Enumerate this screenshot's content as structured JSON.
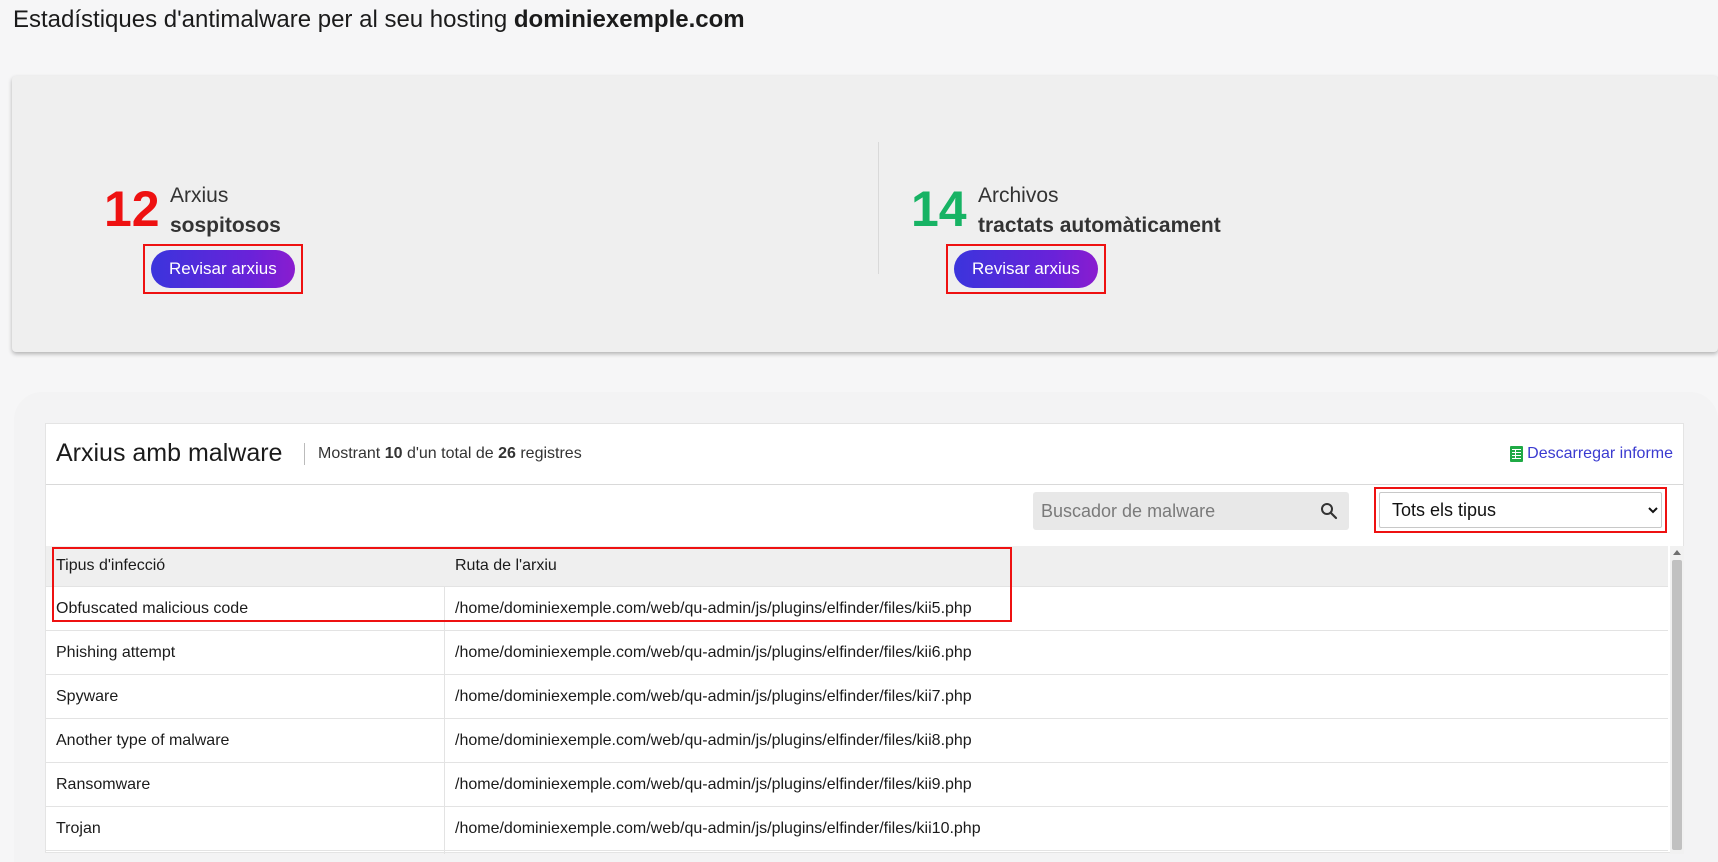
{
  "page": {
    "title_prefix": "Estadístiques d'antimalware per al seu hosting",
    "domain": "dominiexemple.com"
  },
  "stats": {
    "suspicious": {
      "count": "12",
      "line1": "Arxius",
      "line2": "sospitosos",
      "button": "Revisar arxius"
    },
    "treated": {
      "count": "14",
      "line1": "Archivos",
      "line2": "tractats automàticament",
      "button": "Revisar arxius"
    }
  },
  "list": {
    "title": "Arxius amb malware",
    "count_prefix": "Mostrant",
    "count_shown": "10",
    "count_middle": "d'un total de",
    "count_total": "26",
    "count_suffix": "registres",
    "download_label": "Descarregar informe",
    "search_placeholder": "Buscador de malware",
    "filter_selected": "Tots els tipus",
    "columns": [
      "Tipus d'infecció",
      "Ruta de l'arxiu"
    ],
    "rows": [
      {
        "type": "Obfuscated malicious code",
        "path": "/home/dominiexemple.com/web/qu-admin/js/plugins/elfinder/files/kii5.php"
      },
      {
        "type": "Phishing attempt",
        "path": "/home/dominiexemple.com/web/qu-admin/js/plugins/elfinder/files/kii6.php"
      },
      {
        "type": "Spyware",
        "path": "/home/dominiexemple.com/web/qu-admin/js/plugins/elfinder/files/kii7.php"
      },
      {
        "type": "Another type of malware",
        "path": "/home/dominiexemple.com/web/qu-admin/js/plugins/elfinder/files/kii8.php"
      },
      {
        "type": "Ransomware",
        "path": "/home/dominiexemple.com/web/qu-admin/js/plugins/elfinder/files/kii9.php"
      },
      {
        "type": "Trojan",
        "path": "/home/dominiexemple.com/web/qu-admin/js/plugins/elfinder/files/kii10.php"
      }
    ]
  },
  "colors": {
    "suspicious": "#ee1111",
    "treated": "#17b364",
    "highlight": "#ee1111",
    "button_gradient_start": "#3b34dc",
    "button_gradient_end": "#8a1ccf",
    "link": "#3a3ad0"
  },
  "icons": {
    "search": "search-icon",
    "download": "spreadsheet-icon",
    "select": "chevron-down-icon"
  }
}
